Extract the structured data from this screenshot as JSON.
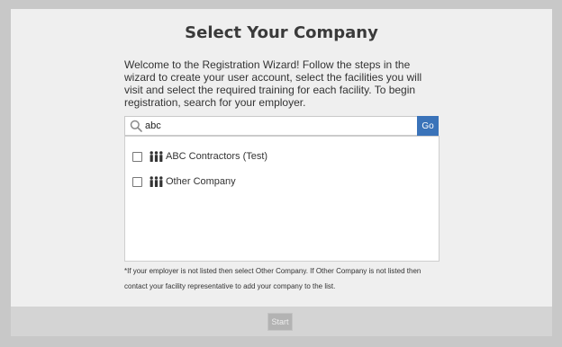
{
  "wizard": {
    "title": "Select Your Company",
    "intro": "Welcome to the Registration Wizard! Follow the steps in the wizard to create your user account, select the facilities you will visit and select the required training for each facility. To begin registration, search for your employer."
  },
  "search": {
    "value": "abc",
    "icon": "search-icon",
    "go_label": "Go",
    "go_color": "#3a73b9"
  },
  "results": [
    {
      "label": "ABC Contractors (Test)",
      "checked": false,
      "icon": "people-icon"
    },
    {
      "label": "Other Company",
      "checked": false,
      "icon": "people-icon"
    }
  ],
  "note": "*If your employer is not listed then select Other Company. If Other Company is not listed then contact your facility representative to add your company to the list.",
  "footer": {
    "start_label": "Start",
    "start_enabled": false
  }
}
